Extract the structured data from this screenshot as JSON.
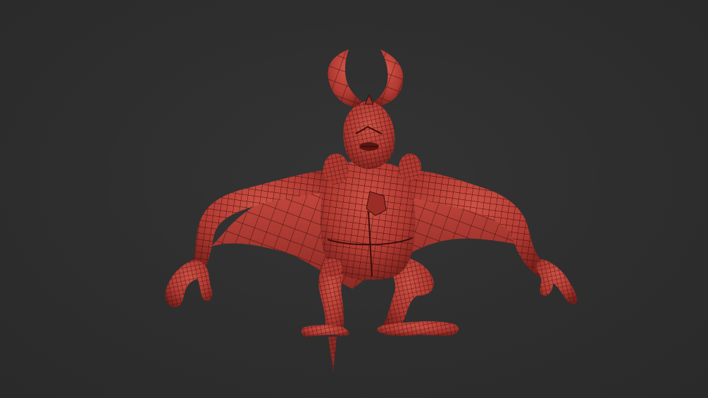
{
  "scene": {
    "background_color": "#2f2f2f",
    "model": {
      "icon": "creature-wireframe-model",
      "base_color": "#b23a32",
      "shadow_color": "#6e1c18",
      "highlight_color": "#d4574b",
      "wire_color": "#3a0d0b"
    }
  }
}
